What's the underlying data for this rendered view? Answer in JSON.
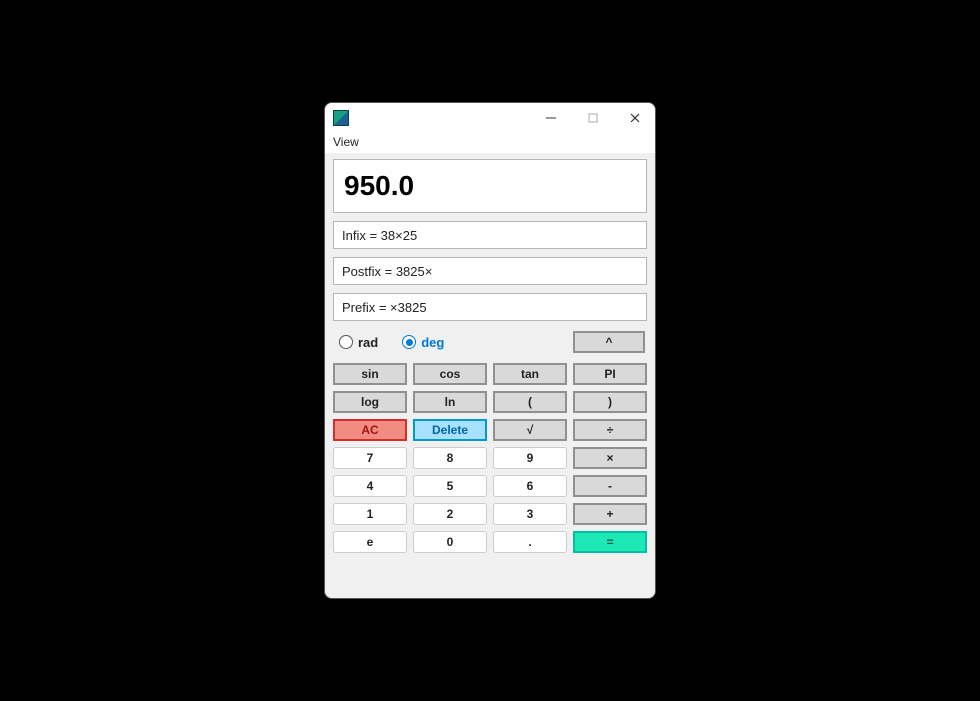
{
  "menu": {
    "view": "View"
  },
  "display": {
    "result": "950.0",
    "infix": "Infix = 38×25",
    "postfix": "Postfix = 3825×",
    "prefix": "Prefix = ×3825"
  },
  "mode": {
    "rad": "rad",
    "deg": "deg",
    "selected": "deg"
  },
  "buttons": {
    "caret": "^",
    "sin": "sin",
    "cos": "cos",
    "tan": "tan",
    "pi": "PI",
    "log": "log",
    "ln": "ln",
    "lparen": "(",
    "rparen": ")",
    "ac": "AC",
    "delete": "Delete",
    "sqrt": "√",
    "divide": "÷",
    "seven": "7",
    "eight": "8",
    "nine": "9",
    "multiply": "×",
    "four": "4",
    "five": "5",
    "six": "6",
    "minus": "-",
    "one": "1",
    "two": "2",
    "three": "3",
    "plus": "+",
    "e": "e",
    "zero": "0",
    "dot": ".",
    "equals": "="
  }
}
